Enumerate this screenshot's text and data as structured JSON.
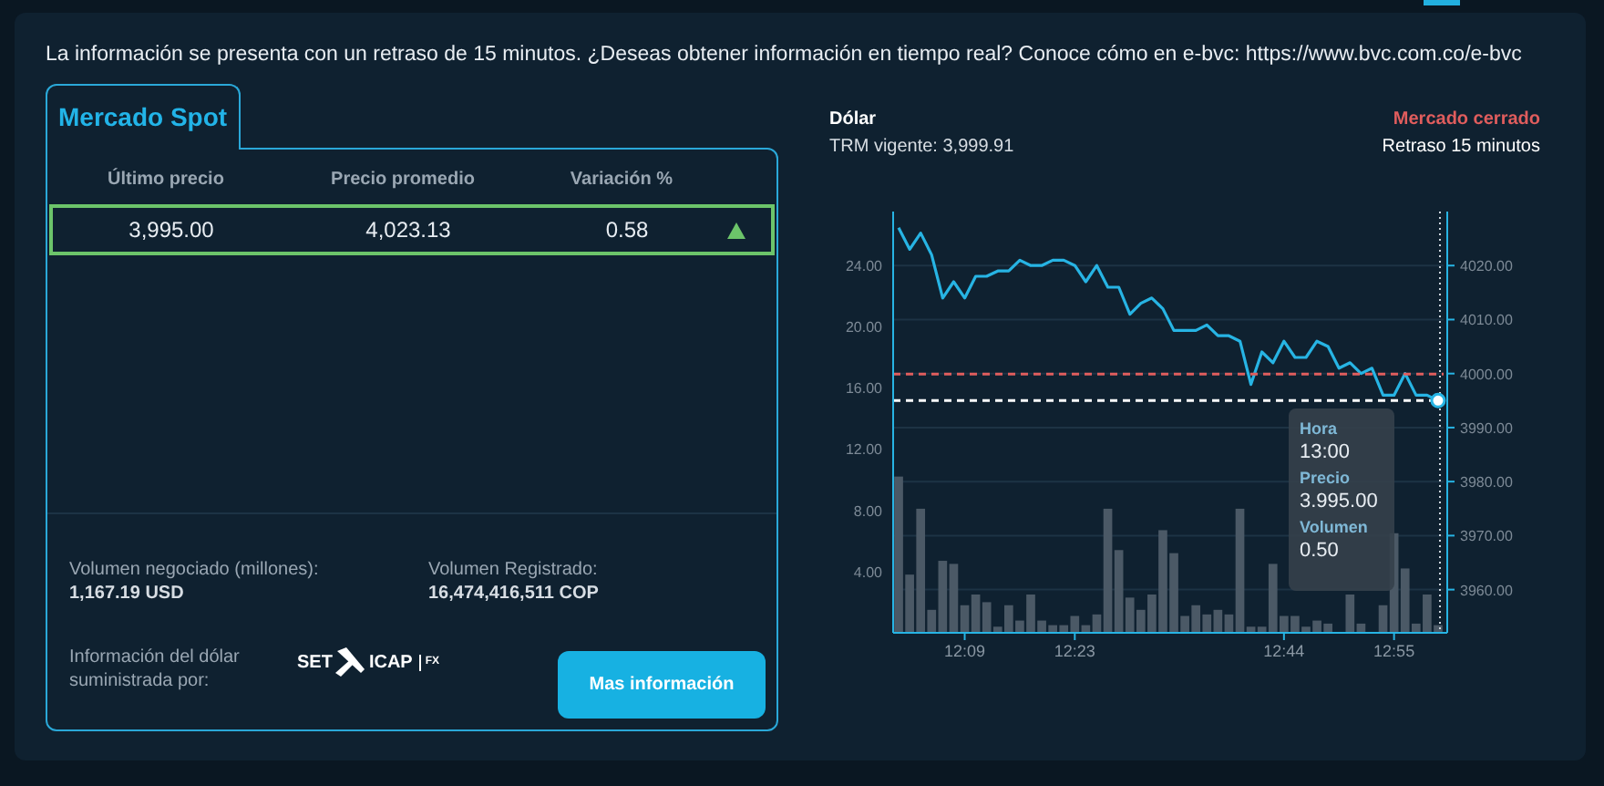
{
  "notice": "La información se presenta con un retraso de 15 minutos. ¿Deseas obtener información en tiempo real? Conoce cómo en e-bvc: https://www.bvc.com.co/e-bvc",
  "tabs": [
    {
      "label": "Mercado Spot",
      "selected": true
    }
  ],
  "table": {
    "columns": [
      "Último precio",
      "Precio promedio",
      "Variación %"
    ],
    "rows": [
      {
        "cells": [
          "3,995.00",
          "4,023.13",
          "0.58"
        ],
        "rising": true,
        "selected": true
      }
    ]
  },
  "stats": [
    {
      "label": "Volumen negociado (millones):",
      "value": "1,167.19 USD"
    },
    {
      "label": "Volumen Registrado:",
      "value": "16,474,416,511 COP"
    }
  ],
  "provider": {
    "label": "Información del dólar suministrada por:",
    "logo": {
      "left": "SET",
      "right": "ICAP",
      "suffix": "FX"
    }
  },
  "more_button": "Mas información",
  "chart_header": {
    "title": "Dólar",
    "trm": "TRM vigente: 3,999.91",
    "market_status": "Mercado cerrado",
    "delay": "Retraso 15 minutos"
  },
  "chart_data": {
    "type": "bar",
    "grid": true,
    "categories": [
      null,
      null,
      null,
      null,
      null,
      null,
      "12:09",
      null,
      null,
      null,
      null,
      null,
      null,
      null,
      null,
      null,
      "12:23",
      null,
      null,
      null,
      null,
      null,
      null,
      null,
      null,
      null,
      null,
      null,
      null,
      null,
      null,
      null,
      null,
      null,
      null,
      "12:44",
      null,
      null,
      null,
      null,
      null,
      null,
      null,
      null,
      null,
      "12:55",
      null,
      null,
      null,
      null
    ],
    "series": [
      {
        "color": "#4b5966",
        "values": [
          10.2,
          3.8,
          8.1,
          1.5,
          4.7,
          4.5,
          1.8,
          2.5,
          2.0,
          0.4,
          1.8,
          0.8,
          2.5,
          0.8,
          0.5,
          0.5,
          1.1,
          0.5,
          1.2,
          8.1,
          5.4,
          2.3,
          1.5,
          2.5,
          6.7,
          5.2,
          1.1,
          1.8,
          1.2,
          1.5,
          1.2,
          8.1,
          0.4,
          0.4,
          4.5,
          1.1,
          1.1,
          0.4,
          0.8,
          0.6,
          null,
          2.5,
          0.6,
          null,
          1.8,
          6.5,
          4.2,
          0.6,
          2.5,
          0.5
        ]
      },
      {
        "color": "#27b4e4",
        "axis": "y2",
        "type": "line",
        "values": [
          4027,
          4023,
          4026,
          4022,
          4014,
          4017,
          4014,
          4018,
          4018,
          4019,
          4019,
          4021,
          4020,
          4020,
          4021,
          4021,
          4020,
          4017,
          4020,
          4016,
          4016,
          4011,
          4013,
          4014,
          4012,
          4008,
          4008,
          4008,
          4009,
          4007,
          4007,
          4006,
          3998,
          4004,
          4002,
          4006,
          4003,
          4003,
          4006,
          4005,
          4001,
          4002,
          4000,
          4001,
          3996,
          3996,
          4000,
          3996,
          3996,
          3995
        ]
      }
    ],
    "ylim": [
      0,
      27.5
    ],
    "yticks": [
      {
        "value": 4,
        "label": "4.00"
      },
      {
        "value": 8,
        "label": "8.00"
      },
      {
        "value": 12,
        "label": "12.00"
      },
      {
        "value": 16,
        "label": "16.00"
      },
      {
        "value": 20,
        "label": "20.00"
      },
      {
        "value": 24,
        "label": "24.00"
      }
    ],
    "y2lim": [
      3952,
      4030
    ],
    "y2ticks": [
      {
        "value": 3960,
        "label": "3960.00"
      },
      {
        "value": 3970,
        "label": "3970.00"
      },
      {
        "value": 3980,
        "label": "3980.00"
      },
      {
        "value": 3990,
        "label": "3990.00"
      },
      {
        "value": 4000,
        "label": "4000.00"
      },
      {
        "value": 4010,
        "label": "4010.00"
      },
      {
        "value": 4020,
        "label": "4020.00"
      }
    ],
    "ref_lines": [
      {
        "axis": "y2",
        "value": 3999.91,
        "color": "#e05d5d"
      },
      {
        "axis": "y2",
        "value": 3995,
        "color": "#ffffff"
      }
    ]
  },
  "tooltip": [
    {
      "label": "Hora",
      "value": "13:00"
    },
    {
      "label": "Precio",
      "value": "3.995.00"
    },
    {
      "label": "Volumen",
      "value": "0.50"
    }
  ]
}
